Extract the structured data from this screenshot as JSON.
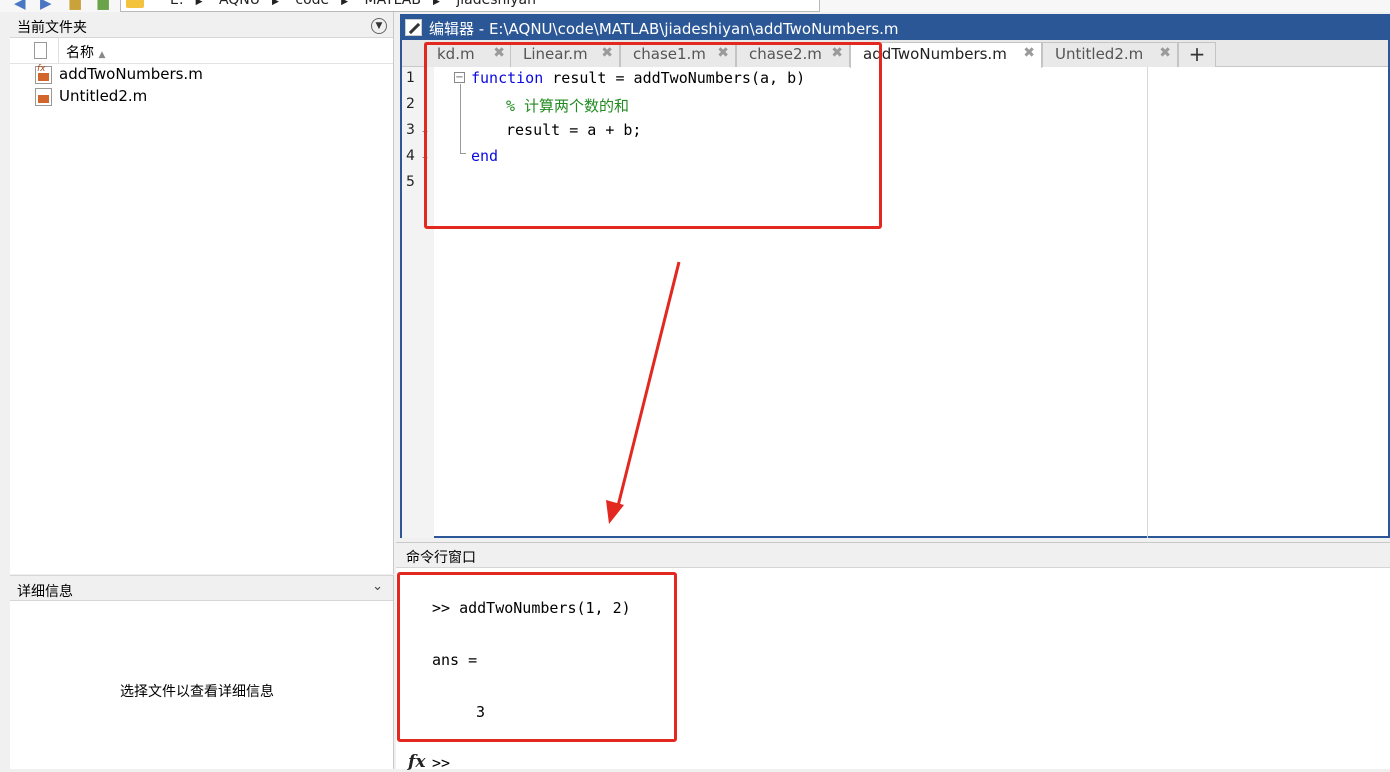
{
  "pathbar": {
    "crumbs": [
      "E:",
      "AQNU",
      "code",
      "MATLAB",
      "jiadeshiyan"
    ]
  },
  "file_panel": {
    "title": "当前文件夹",
    "name_column": "名称",
    "files": [
      {
        "name": "addTwoNumbers.m",
        "icon": "function-file-icon"
      },
      {
        "name": "Untitled2.m",
        "icon": "script-file-icon"
      }
    ]
  },
  "details_panel": {
    "title": "详细信息",
    "message": "选择文件以查看详细信息"
  },
  "editor": {
    "title": "编辑器 - E:\\AQNU\\code\\MATLAB\\jiadeshiyan\\addTwoNumbers.m",
    "tabs": [
      {
        "label": "kd.m"
      },
      {
        "label": "Linear.m"
      },
      {
        "label": "chase1.m"
      },
      {
        "label": "chase2.m"
      },
      {
        "label": "addTwoNumbers.m"
      },
      {
        "label": "Untitled2.m"
      }
    ],
    "add_tab": "+",
    "line_numbers": [
      "1",
      "2",
      "3",
      "4",
      "5"
    ],
    "code": {
      "l1_kw": "function",
      "l1_rest": " result = addTwoNumbers(a, b)",
      "l2_comment": "% 计算两个数的和",
      "l3": "result = a + b;",
      "l4_kw": "end"
    }
  },
  "command_window": {
    "title": "命令行窗口",
    "lines": [
      ">> addTwoNumbers(1, 2)",
      "ans =",
      "3"
    ],
    "prompt": ">>",
    "fx_label": "fx"
  },
  "colors": {
    "editor_title_bg": "#2b5796",
    "keyword": "#0a0ae0",
    "comment": "#228b22",
    "annotation_red": "#e3281f"
  }
}
